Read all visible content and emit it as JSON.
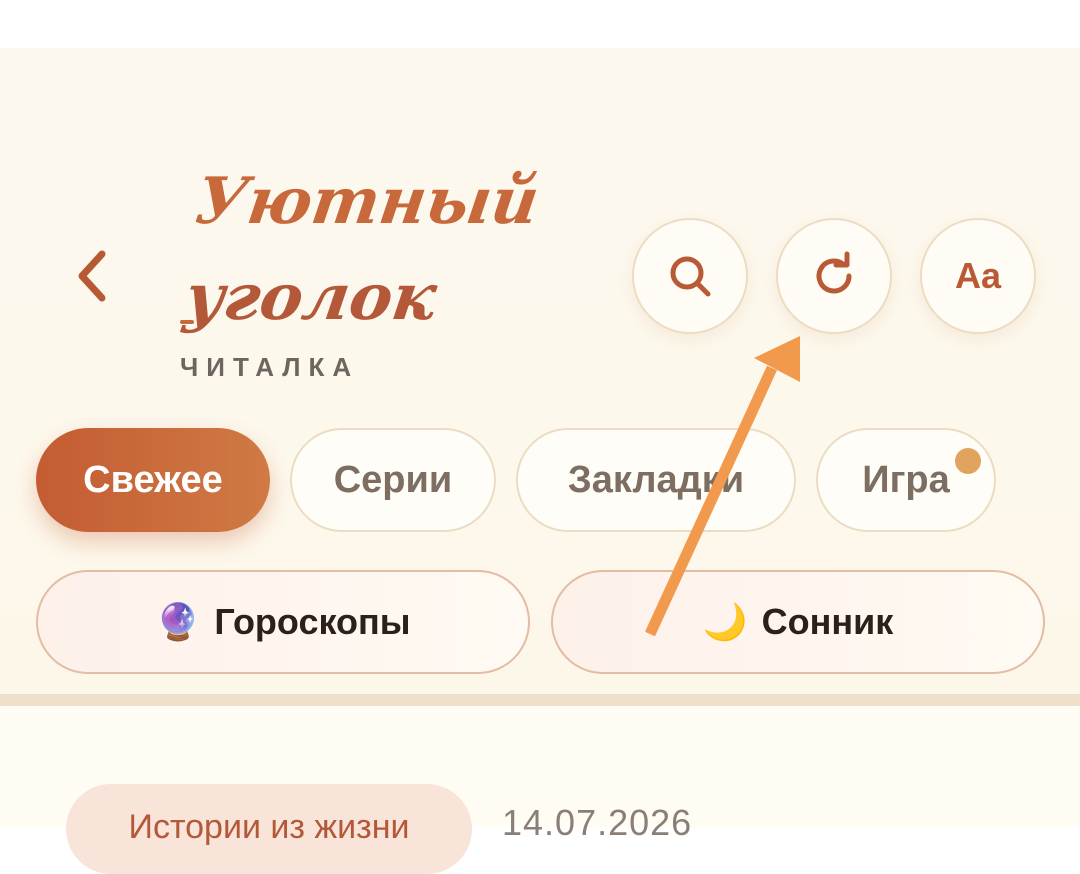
{
  "header": {
    "back_label": "‹",
    "brand_line1": "Уютный",
    "brand_line2": "уголок",
    "subtitle": "ЧИТАЛКА",
    "font_button_label": "Aa"
  },
  "tabs": [
    {
      "label": "Свежее",
      "active": true
    },
    {
      "label": "Серии",
      "active": false
    },
    {
      "label": "Закладки",
      "active": false
    },
    {
      "label": "Игра",
      "active": false,
      "has_badge": true
    }
  ],
  "pills": [
    {
      "icon": "🔮",
      "label": "Гороскопы"
    },
    {
      "icon": "🌙",
      "label": "Сонник"
    }
  ],
  "content": {
    "category": "Истории из жизни",
    "date": "14.07.2026"
  },
  "colors": {
    "accent": "#c35c32",
    "background": "#fcf8ee",
    "badge": "#e0a45e",
    "annotation_arrow": "#f19a4d"
  },
  "icons": {
    "back": "chevron-left-icon",
    "search": "search-icon",
    "refresh": "refresh-icon",
    "font": "font-size-icon"
  }
}
